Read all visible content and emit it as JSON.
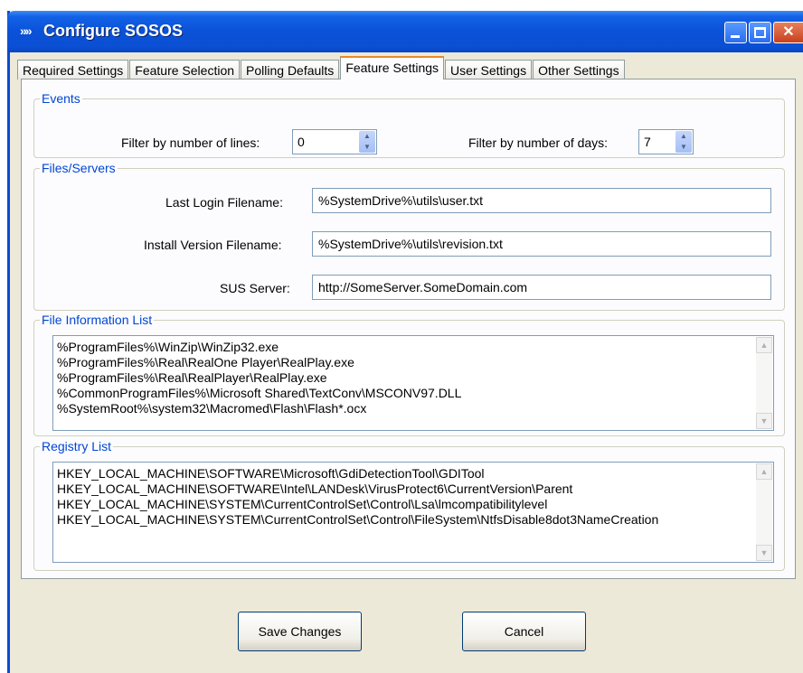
{
  "window": {
    "title": "Configure SOSOS",
    "app_icon": "sososs-app-icon",
    "controls": [
      "minimize-icon",
      "maximize-icon",
      "close-icon"
    ]
  },
  "tabs": [
    {
      "label": "Required Settings",
      "active": false
    },
    {
      "label": "Feature Selection",
      "active": false
    },
    {
      "label": "Polling Defaults",
      "active": false
    },
    {
      "label": "Feature Settings",
      "active": true
    },
    {
      "label": "User Settings",
      "active": false
    },
    {
      "label": "Other Settings",
      "active": false
    }
  ],
  "events": {
    "legend": "Events",
    "lines_label": "Filter by number of lines:",
    "lines_value": "0",
    "days_label": "Filter by number of days:",
    "days_value": "7"
  },
  "files_servers": {
    "legend": "Files/Servers",
    "last_login_label": "Last Login Filename:",
    "last_login_value": "%SystemDrive%\\utils\\user.txt",
    "install_version_label": "Install Version Filename:",
    "install_version_value": "%SystemDrive%\\utils\\revision.txt",
    "sus_server_label": "SUS Server:",
    "sus_server_value": "http://SomeServer.SomeDomain.com"
  },
  "file_info": {
    "legend": "File Information List",
    "items": [
      "%ProgramFiles%\\WinZip\\WinZip32.exe",
      "%ProgramFiles%\\Real\\RealOne Player\\RealPlay.exe",
      "%ProgramFiles%\\Real\\RealPlayer\\RealPlay.exe",
      "%CommonProgramFiles%\\Microsoft Shared\\TextConv\\MSCONV97.DLL",
      "%SystemRoot%\\system32\\Macromed\\Flash\\Flash*.ocx"
    ]
  },
  "registry": {
    "legend": "Registry List",
    "items": [
      "HKEY_LOCAL_MACHINE\\SOFTWARE\\Microsoft\\GdiDetectionTool\\GDITool",
      "HKEY_LOCAL_MACHINE\\SOFTWARE\\Intel\\LANDesk\\VirusProtect6\\CurrentVersion\\Parent",
      "HKEY_LOCAL_MACHINE\\SYSTEM\\CurrentControlSet\\Control\\Lsa\\lmcompatibilitylevel",
      "HKEY_LOCAL_MACHINE\\SYSTEM\\CurrentControlSet\\Control\\FileSystem\\NtfsDisable8dot3NameCreation"
    ]
  },
  "buttons": {
    "save": "Save Changes",
    "cancel": "Cancel"
  },
  "colors": {
    "titlebar": "#0a52d8",
    "active_tab_accent": "#e68b2c",
    "group_legend": "#0046d5",
    "dialog_background": "#ece9d8"
  }
}
